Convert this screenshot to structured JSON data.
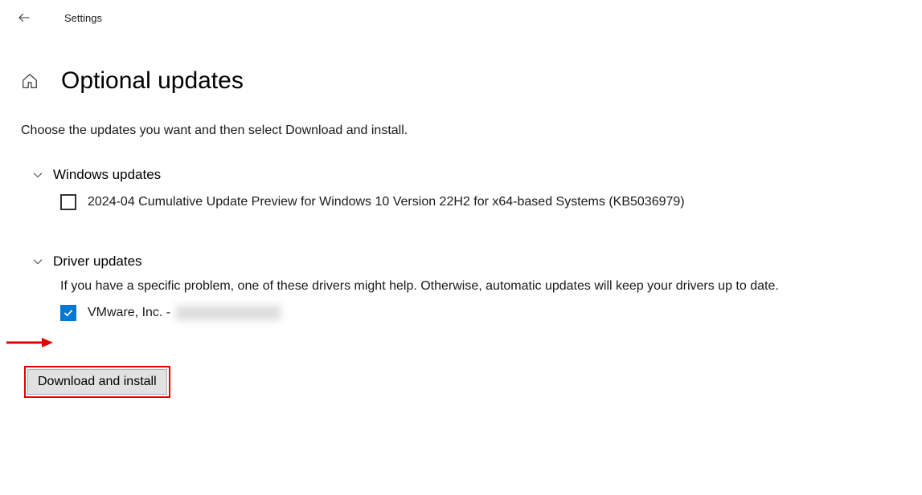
{
  "header": {
    "app_name": "Settings"
  },
  "page": {
    "title": "Optional updates",
    "instruction": "Choose the updates you want and then select Download and install."
  },
  "sections": {
    "windows": {
      "title": "Windows updates",
      "items": [
        {
          "label": "2024-04 Cumulative Update Preview for Windows 10 Version 22H2 for x64-based Systems (KB5036979)",
          "checked": false
        }
      ]
    },
    "driver": {
      "title": "Driver updates",
      "description": "If you have a specific problem, one of these drivers might help. Otherwise, automatic updates will keep your drivers up to date.",
      "items": [
        {
          "label_prefix": "VMware, Inc. - ",
          "checked": true
        }
      ]
    }
  },
  "button": {
    "download_install": "Download and install"
  }
}
